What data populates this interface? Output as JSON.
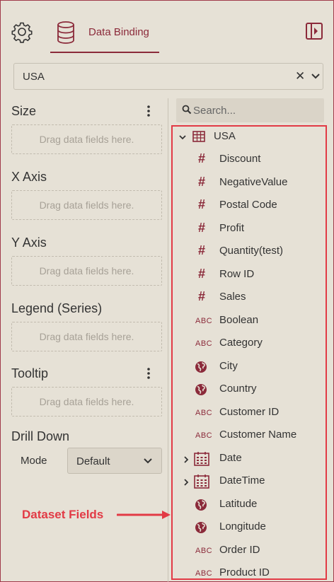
{
  "header": {
    "tab_label": "Data Binding"
  },
  "dataset": {
    "selected": "USA",
    "clear_symbol": "✕"
  },
  "wells": [
    {
      "title": "Size",
      "placeholder": "Drag data fields here.",
      "has_menu": true
    },
    {
      "title": "X Axis",
      "placeholder": "Drag data fields here.",
      "has_menu": false
    },
    {
      "title": "Y Axis",
      "placeholder": "Drag data fields here.",
      "has_menu": false
    },
    {
      "title": "Legend (Series)",
      "placeholder": "Drag data fields here.",
      "has_menu": false
    },
    {
      "title": "Tooltip",
      "placeholder": "Drag data fields here.",
      "has_menu": true
    }
  ],
  "drill_down": {
    "title": "Drill Down",
    "mode_label": "Mode",
    "mode_value": "Default"
  },
  "search": {
    "placeholder": "Search..."
  },
  "tree": {
    "root_label": "USA",
    "fields": [
      {
        "label": "Discount",
        "type": "number",
        "icon_text": "#"
      },
      {
        "label": "NegativeValue",
        "type": "number",
        "icon_text": "#"
      },
      {
        "label": "Postal Code",
        "type": "number",
        "icon_text": "#"
      },
      {
        "label": "Profit",
        "type": "number",
        "icon_text": "#"
      },
      {
        "label": "Quantity(test)",
        "type": "number",
        "icon_text": "#"
      },
      {
        "label": "Row ID",
        "type": "number",
        "icon_text": "#"
      },
      {
        "label": "Sales",
        "type": "number",
        "icon_text": "#"
      },
      {
        "label": "Boolean",
        "type": "string",
        "icon_text": "ABC"
      },
      {
        "label": "Category",
        "type": "string",
        "icon_text": "ABC"
      },
      {
        "label": "City",
        "type": "geo",
        "icon_text": ""
      },
      {
        "label": "Country",
        "type": "geo",
        "icon_text": ""
      },
      {
        "label": "Customer ID",
        "type": "string",
        "icon_text": "ABC"
      },
      {
        "label": "Customer Name",
        "type": "string",
        "icon_text": "ABC"
      },
      {
        "label": "Date",
        "type": "date",
        "icon_text": ""
      },
      {
        "label": "DateTime",
        "type": "date",
        "icon_text": ""
      },
      {
        "label": "Latitude",
        "type": "geo",
        "icon_text": ""
      },
      {
        "label": "Longitude",
        "type": "geo",
        "icon_text": ""
      },
      {
        "label": "Order ID",
        "type": "string",
        "icon_text": "ABC"
      },
      {
        "label": "Product ID",
        "type": "string",
        "icon_text": "ABC"
      }
    ]
  },
  "annotation": {
    "label": "Dataset Fields"
  },
  "colors": {
    "accent": "#8b2a3a",
    "highlight": "#e23a45",
    "background": "#e6e1d6"
  }
}
